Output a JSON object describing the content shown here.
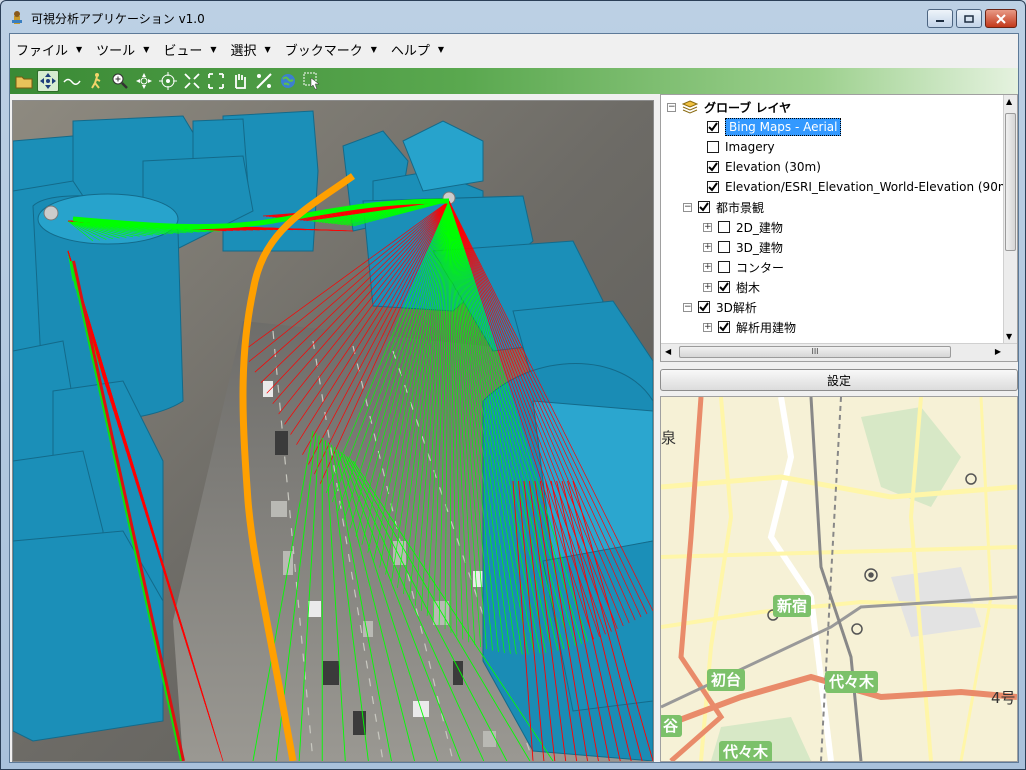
{
  "window": {
    "title": "可視分析アプリケーション v1.0"
  },
  "menu": [
    {
      "label": "ファイル"
    },
    {
      "label": "ツール"
    },
    {
      "label": "ビュー"
    },
    {
      "label": "選択"
    },
    {
      "label": "ブックマーク"
    },
    {
      "label": "ヘルプ"
    }
  ],
  "toolbar_icons": [
    "open-folder-icon",
    "pan-icon",
    "line-icon",
    "walk-icon",
    "zoom-in-icon",
    "zoom-full-icon",
    "target-icon",
    "shrink-icon",
    "expand-icon",
    "hand-icon",
    "measure-icon",
    "globe-icon",
    "select-icon"
  ],
  "layers": {
    "root": "グローブ レイヤ",
    "items": [
      {
        "label": "Bing Maps - Aerial",
        "checked": true
      },
      {
        "label": "Imagery",
        "checked": false
      },
      {
        "label": "Elevation (30m)",
        "checked": true
      },
      {
        "label": "Elevation/ESRI_Elevation_World-Elevation (90m",
        "checked": true
      },
      {
        "label": "都市景観",
        "checked": true
      },
      {
        "label": "2D_建物",
        "checked": false
      },
      {
        "label": "3D_建物",
        "checked": false
      },
      {
        "label": "コンター",
        "checked": false
      },
      {
        "label": "樹木",
        "checked": true
      },
      {
        "label": "3D解析",
        "checked": true
      },
      {
        "label": "解析用建物",
        "checked": true
      }
    ],
    "scroll_grip": "III"
  },
  "settings_button": "設定",
  "map": {
    "stations": [
      "新宿",
      "初台",
      "代々木",
      "代々木"
    ],
    "edge_left_top": "泉",
    "edge_left_bottom": "谷",
    "edge_right": "4号"
  },
  "colors": {
    "toolbar_green": "#3a8a35",
    "building_blue": "#1b8fb8",
    "visible_line": "#00ff00",
    "hidden_line": "#ff0000",
    "route": "#ffa000",
    "selection": "#3399ff"
  }
}
